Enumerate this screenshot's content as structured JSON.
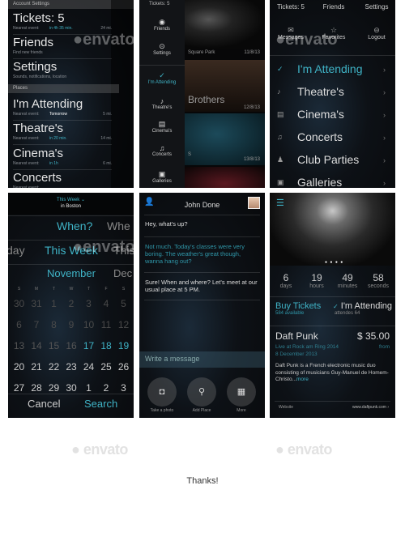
{
  "accent": "#3fb3c6",
  "menu_screen": {
    "sections": [
      "Account Settings",
      "Places"
    ],
    "items": [
      {
        "title": "Tickets: 5",
        "sub": "Nearest event:",
        "highlight": "in 4h 35 min.",
        "dist": "24 mi."
      },
      {
        "title": "Friends",
        "sub": "Find new friends"
      },
      {
        "title": "Settings",
        "sub": "Sounds, notifications, location"
      },
      {
        "title": "I'm Attending",
        "sub": "Nearest event:",
        "highlight": "Tomorrow",
        "dist": "5 mi."
      },
      {
        "title": "Theatre's",
        "sub": "Nearest event:",
        "highlight": "in 20 min.",
        "dist": "14 mi."
      },
      {
        "title": "Cinema's",
        "sub": "Nearest event:",
        "highlight": "in 1h",
        "dist": "6 mi."
      },
      {
        "title": "Concerts",
        "sub": "Nearest event:"
      }
    ]
  },
  "sidebar_screen": {
    "top": "Tickets: 5",
    "items": [
      {
        "label": "Friends",
        "icon": "user-icon"
      },
      {
        "label": "Settings",
        "icon": "gear-icon"
      },
      {
        "label": "I'm Attending",
        "icon": "check-circle-icon"
      },
      {
        "label": "Theatre's",
        "icon": "mask-icon"
      },
      {
        "label": "Cinema's",
        "icon": "film-icon"
      },
      {
        "label": "Concerts",
        "icon": "music-icon"
      },
      {
        "label": "Galleries",
        "icon": "gallery-icon"
      }
    ],
    "events": [
      {
        "name": "Square Park",
        "date": "11/8/13"
      },
      {
        "name": "Brothers",
        "date": "12/8/13"
      },
      {
        "name": "S",
        "date": "13/8/13"
      }
    ]
  },
  "grid_screen": {
    "top": [
      "Tickets: 5",
      "Friends",
      "Settings"
    ],
    "actions": [
      {
        "label": "Messages",
        "icon": "envelope-icon"
      },
      {
        "label": "Favorites",
        "icon": "star-icon"
      },
      {
        "label": "Logout",
        "icon": "logout-icon"
      }
    ],
    "items": [
      {
        "label": "I'm Attending",
        "icon": "check-circle-icon"
      },
      {
        "label": "Theatre's",
        "icon": "mask-icon"
      },
      {
        "label": "Cinema's",
        "icon": "film-icon"
      },
      {
        "label": "Concerts",
        "icon": "music-icon"
      },
      {
        "label": "Club Parties",
        "icon": "club-icon"
      },
      {
        "label": "Galleries",
        "icon": "gallery-icon"
      }
    ]
  },
  "calendar_screen": {
    "filter": "This Week",
    "location": "in Boston",
    "when_row": [
      "When?",
      "Whe"
    ],
    "range_row": [
      "day",
      "This Week",
      "This"
    ],
    "month_row": [
      "November",
      "Dec"
    ],
    "weekdays": [
      "S",
      "M",
      "T",
      "W",
      "T",
      "F",
      "S"
    ],
    "weeks": [
      [
        "30",
        "31",
        "1",
        "2",
        "3",
        "4",
        "5"
      ],
      [
        "6",
        "7",
        "8",
        "9",
        "10",
        "11",
        "12"
      ],
      [
        "13",
        "14",
        "15",
        "16",
        "17",
        "18",
        "19"
      ],
      [
        "20",
        "21",
        "22",
        "23",
        "24",
        "25",
        "26"
      ],
      [
        "27",
        "28",
        "29",
        "30",
        "1",
        "2",
        "3"
      ]
    ],
    "cancel": "Cancel",
    "search": "Search"
  },
  "chat_screen": {
    "contact": "John Done",
    "messages": [
      {
        "text": "Hey, what's up?",
        "mine": false
      },
      {
        "text": "Not much. Today's classes were very boring. The weather's great though, wanna hang out?",
        "mine": true
      },
      {
        "text": "Sure! When and where? Let's meet at our usual place at 5 PM.",
        "mine": false
      }
    ],
    "placeholder": "Write a message",
    "actions": [
      {
        "label": "Take a photo",
        "icon": "camera-icon"
      },
      {
        "label": "Add Place",
        "icon": "pin-icon"
      },
      {
        "label": "More",
        "icon": "grid-icon"
      }
    ]
  },
  "event_screen": {
    "countdown": [
      {
        "v": "6",
        "u": "days"
      },
      {
        "v": "19",
        "u": "hours"
      },
      {
        "v": "49",
        "u": "minutes"
      },
      {
        "v": "58",
        "u": "seconds"
      }
    ],
    "buy": "Buy Tickets",
    "available": "584 available",
    "attending": "I'm Attending",
    "attendees": "attendes 64",
    "name": "Daft Punk",
    "price": "$ 35.00",
    "from": "from",
    "venue": "Live at Rock am Ring 2014",
    "date": "8 December 2013",
    "desc": "Daft Punk is a French electronic music duo consisting of musicians Guy-Manuel de Homem-Christo...",
    "more": "more",
    "website_label": "Website",
    "website": "www.daftpunk.com"
  },
  "watermark": "envato",
  "thanks": "Thanks!"
}
